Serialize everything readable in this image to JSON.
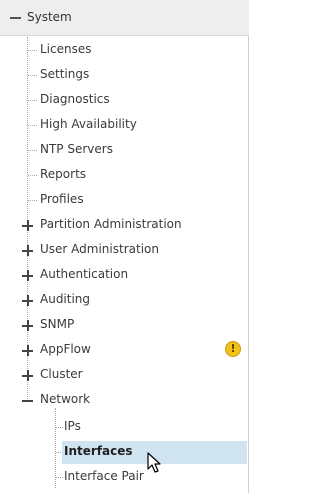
{
  "header": {
    "label": "System",
    "expanded": true
  },
  "tree": {
    "children": [
      {
        "label": "Licenses"
      },
      {
        "label": "Settings"
      },
      {
        "label": "Diagnostics"
      },
      {
        "label": "High Availability"
      },
      {
        "label": "NTP Servers"
      },
      {
        "label": "Reports"
      },
      {
        "label": "Profiles"
      },
      {
        "label": "Partition Administration",
        "expandable": true
      },
      {
        "label": "User Administration",
        "expandable": true
      },
      {
        "label": "Authentication",
        "expandable": true
      },
      {
        "label": "Auditing",
        "expandable": true
      },
      {
        "label": "SNMP",
        "expandable": true
      },
      {
        "label": "AppFlow",
        "expandable": true,
        "badge": "warning-icon"
      },
      {
        "label": "Cluster",
        "expandable": true
      },
      {
        "label": "Network",
        "expanded": true
      }
    ],
    "network_children": [
      {
        "label": "IPs"
      },
      {
        "label": "Interfaces",
        "selected": true
      },
      {
        "label": "Interface Pair"
      }
    ]
  },
  "badges": {
    "appflow_warning": "!"
  },
  "colors": {
    "selected_bg": "#cfe3f1",
    "warning": "#f2c21a",
    "header_bg": "#eeeeee"
  }
}
